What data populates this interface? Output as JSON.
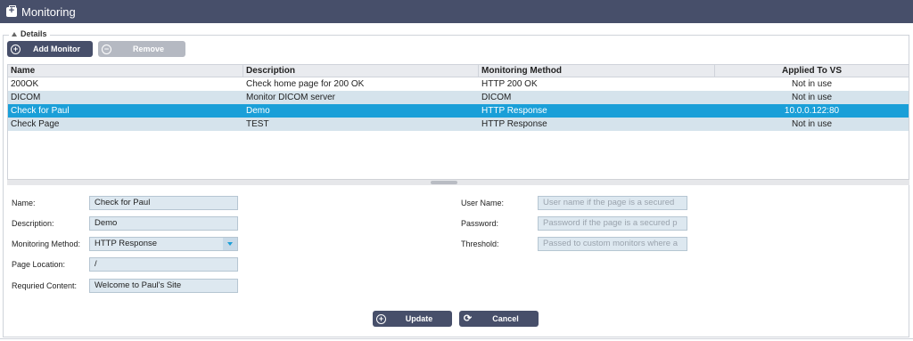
{
  "window": {
    "title": "Monitoring",
    "title_icon": "first-aid-kit-icon"
  },
  "section": {
    "legend": "Details"
  },
  "toolbar": {
    "add_label": "Add Monitor",
    "remove_label": "Remove"
  },
  "grid": {
    "headers": [
      "Name",
      "Description",
      "Monitoring Method",
      "Applied To VS"
    ],
    "rows": [
      {
        "name": "200OK",
        "description": "Check home page for 200 OK",
        "method": "HTTP 200 OK",
        "applied": "Not in use"
      },
      {
        "name": "DICOM",
        "description": "Monitor DICOM server",
        "method": "DICOM",
        "applied": "Not in use"
      },
      {
        "name": "Check for Paul",
        "description": "Demo",
        "method": "HTTP Response",
        "applied": "10.0.0.122:80"
      },
      {
        "name": "Check Page",
        "description": "TEST",
        "method": "HTTP Response",
        "applied": "Not in use"
      }
    ]
  },
  "form": {
    "name_label": "Name:",
    "name_value": "Check for Paul",
    "description_label": "Description:",
    "description_value": "Demo",
    "method_label": "Monitoring Method:",
    "method_value": "HTTP Response",
    "page_label": "Page Location:",
    "page_value": "/",
    "content_label": "Requried Content:",
    "content_value": "Welcome to Paul's Site",
    "user_label": "User Name:",
    "user_placeholder": "User name if the page is a secured",
    "password_label": "Password:",
    "password_placeholder": "Password if the page is a secured p",
    "threshold_label": "Threshold:",
    "threshold_placeholder": "Passed to custom monitors where a"
  },
  "actions": {
    "update_label": "Update",
    "cancel_label": "Cancel"
  },
  "colors": {
    "header": "#474f6a",
    "selected_row": "#1a9fd8",
    "alt_row": "#d5e3ec",
    "input_bg": "#dde8f0"
  }
}
